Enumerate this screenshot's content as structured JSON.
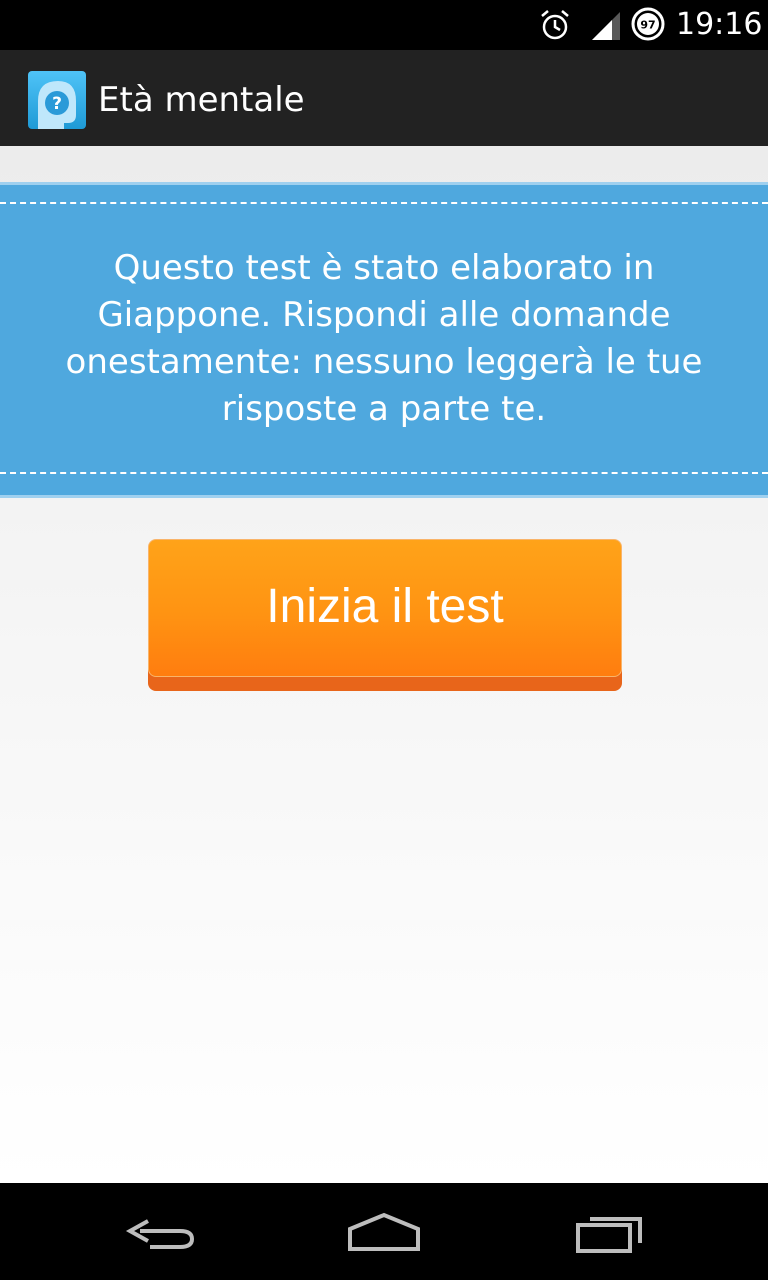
{
  "status_bar": {
    "time": "19:16",
    "battery_level": "97",
    "icons": [
      "alarm-icon",
      "signal-icon",
      "battery-icon"
    ]
  },
  "action_bar": {
    "title": "Età mentale",
    "icon": "app-face-question-icon"
  },
  "main": {
    "info_text": "Questo test è stato elaborato in Giappone. Rispondi alle domande onestamente: nessuno leggerà le tue risposte a parte te.",
    "start_button_label": "Inizia il test"
  },
  "nav_bar": {
    "icons": [
      "back-icon",
      "home-icon",
      "recents-icon"
    ]
  },
  "colors": {
    "banner": "#4fa8de",
    "button": "#ff9312",
    "action_bar": "#222222"
  }
}
